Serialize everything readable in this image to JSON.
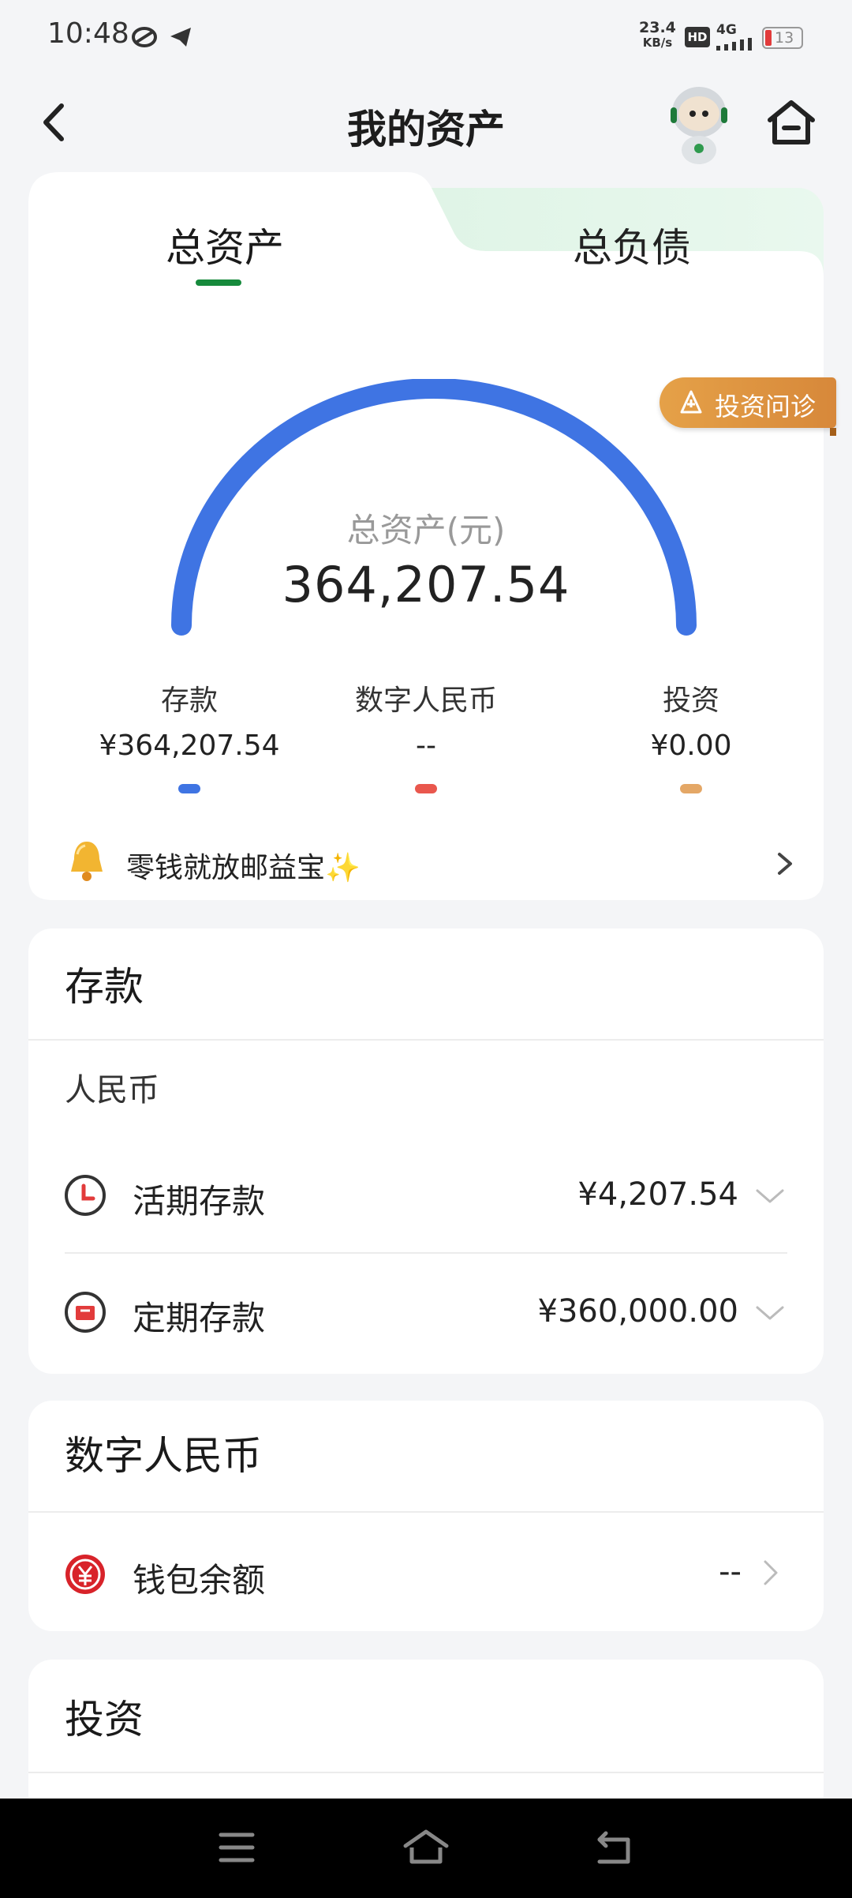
{
  "status": {
    "time": "10:48",
    "net_speed": "23.4",
    "net_speed_unit": "KB/s",
    "hd": "HD",
    "network": "4G",
    "battery": "13"
  },
  "nav": {
    "title": "我的资产"
  },
  "tabs": {
    "total_assets": "总资产",
    "total_liabilities": "总负债"
  },
  "gauge": {
    "label": "总资产(元)",
    "value": "364,207.54"
  },
  "diagnosis_button": "投资问诊",
  "categories": [
    {
      "name": "存款",
      "value": "¥364,207.54",
      "color": "#3f74e3"
    },
    {
      "name": "数字人民币",
      "value": "--",
      "color": "#e9574d"
    },
    {
      "name": "投资",
      "value": "¥0.00",
      "color": "#e4a766"
    }
  ],
  "promo": {
    "text": "零钱就放邮益宝✨"
  },
  "deposits": {
    "title": "存款",
    "currency": "人民币",
    "items": [
      {
        "label": "活期存款",
        "value": "¥4,207.54"
      },
      {
        "label": "定期存款",
        "value": "¥360,000.00"
      }
    ]
  },
  "ecny": {
    "title": "数字人民币",
    "wallet_label": "钱包余额",
    "wallet_value": "--"
  },
  "invest": {
    "title": "投资"
  },
  "colors": {
    "accent_green": "#168a3c",
    "gauge_blue": "#3f74e3",
    "diagnosis_orange": "#d7883a",
    "ecny_red": "#d8232a"
  }
}
